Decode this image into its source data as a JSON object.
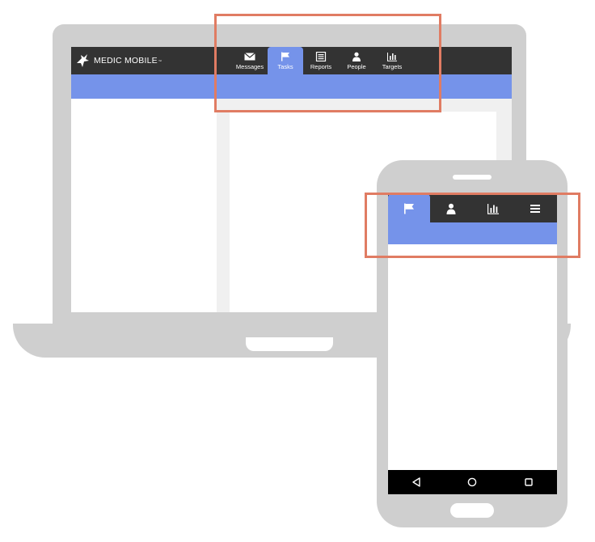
{
  "colors": {
    "device_gray": "#cfcfcf",
    "header_dark": "#333333",
    "accent_blue": "#7593ea",
    "highlight_orange": "#e07c63",
    "content_bg": "#ffffff",
    "gutter_gray": "#f0f0f0"
  },
  "desktop": {
    "brand": {
      "name": "MEDIC MOBILE",
      "tm": "™",
      "logo_icon": "medic-mobile-logo-icon"
    },
    "tabs": [
      {
        "label": "Messages",
        "icon": "envelope-icon",
        "active": false
      },
      {
        "label": "Tasks",
        "icon": "flag-icon",
        "active": true
      },
      {
        "label": "Reports",
        "icon": "list-icon",
        "active": false
      },
      {
        "label": "People",
        "icon": "person-icon",
        "active": false
      },
      {
        "label": "Targets",
        "icon": "bar-chart-icon",
        "active": false
      }
    ]
  },
  "mobile": {
    "tabs": [
      {
        "icon": "flag-icon",
        "active": true
      },
      {
        "icon": "person-icon",
        "active": false
      },
      {
        "icon": "bar-chart-icon",
        "active": false
      },
      {
        "icon": "hamburger-menu-icon",
        "active": false
      }
    ],
    "nav_buttons": [
      {
        "icon": "back-triangle-icon"
      },
      {
        "icon": "home-circle-icon"
      },
      {
        "icon": "recents-square-icon"
      }
    ]
  }
}
